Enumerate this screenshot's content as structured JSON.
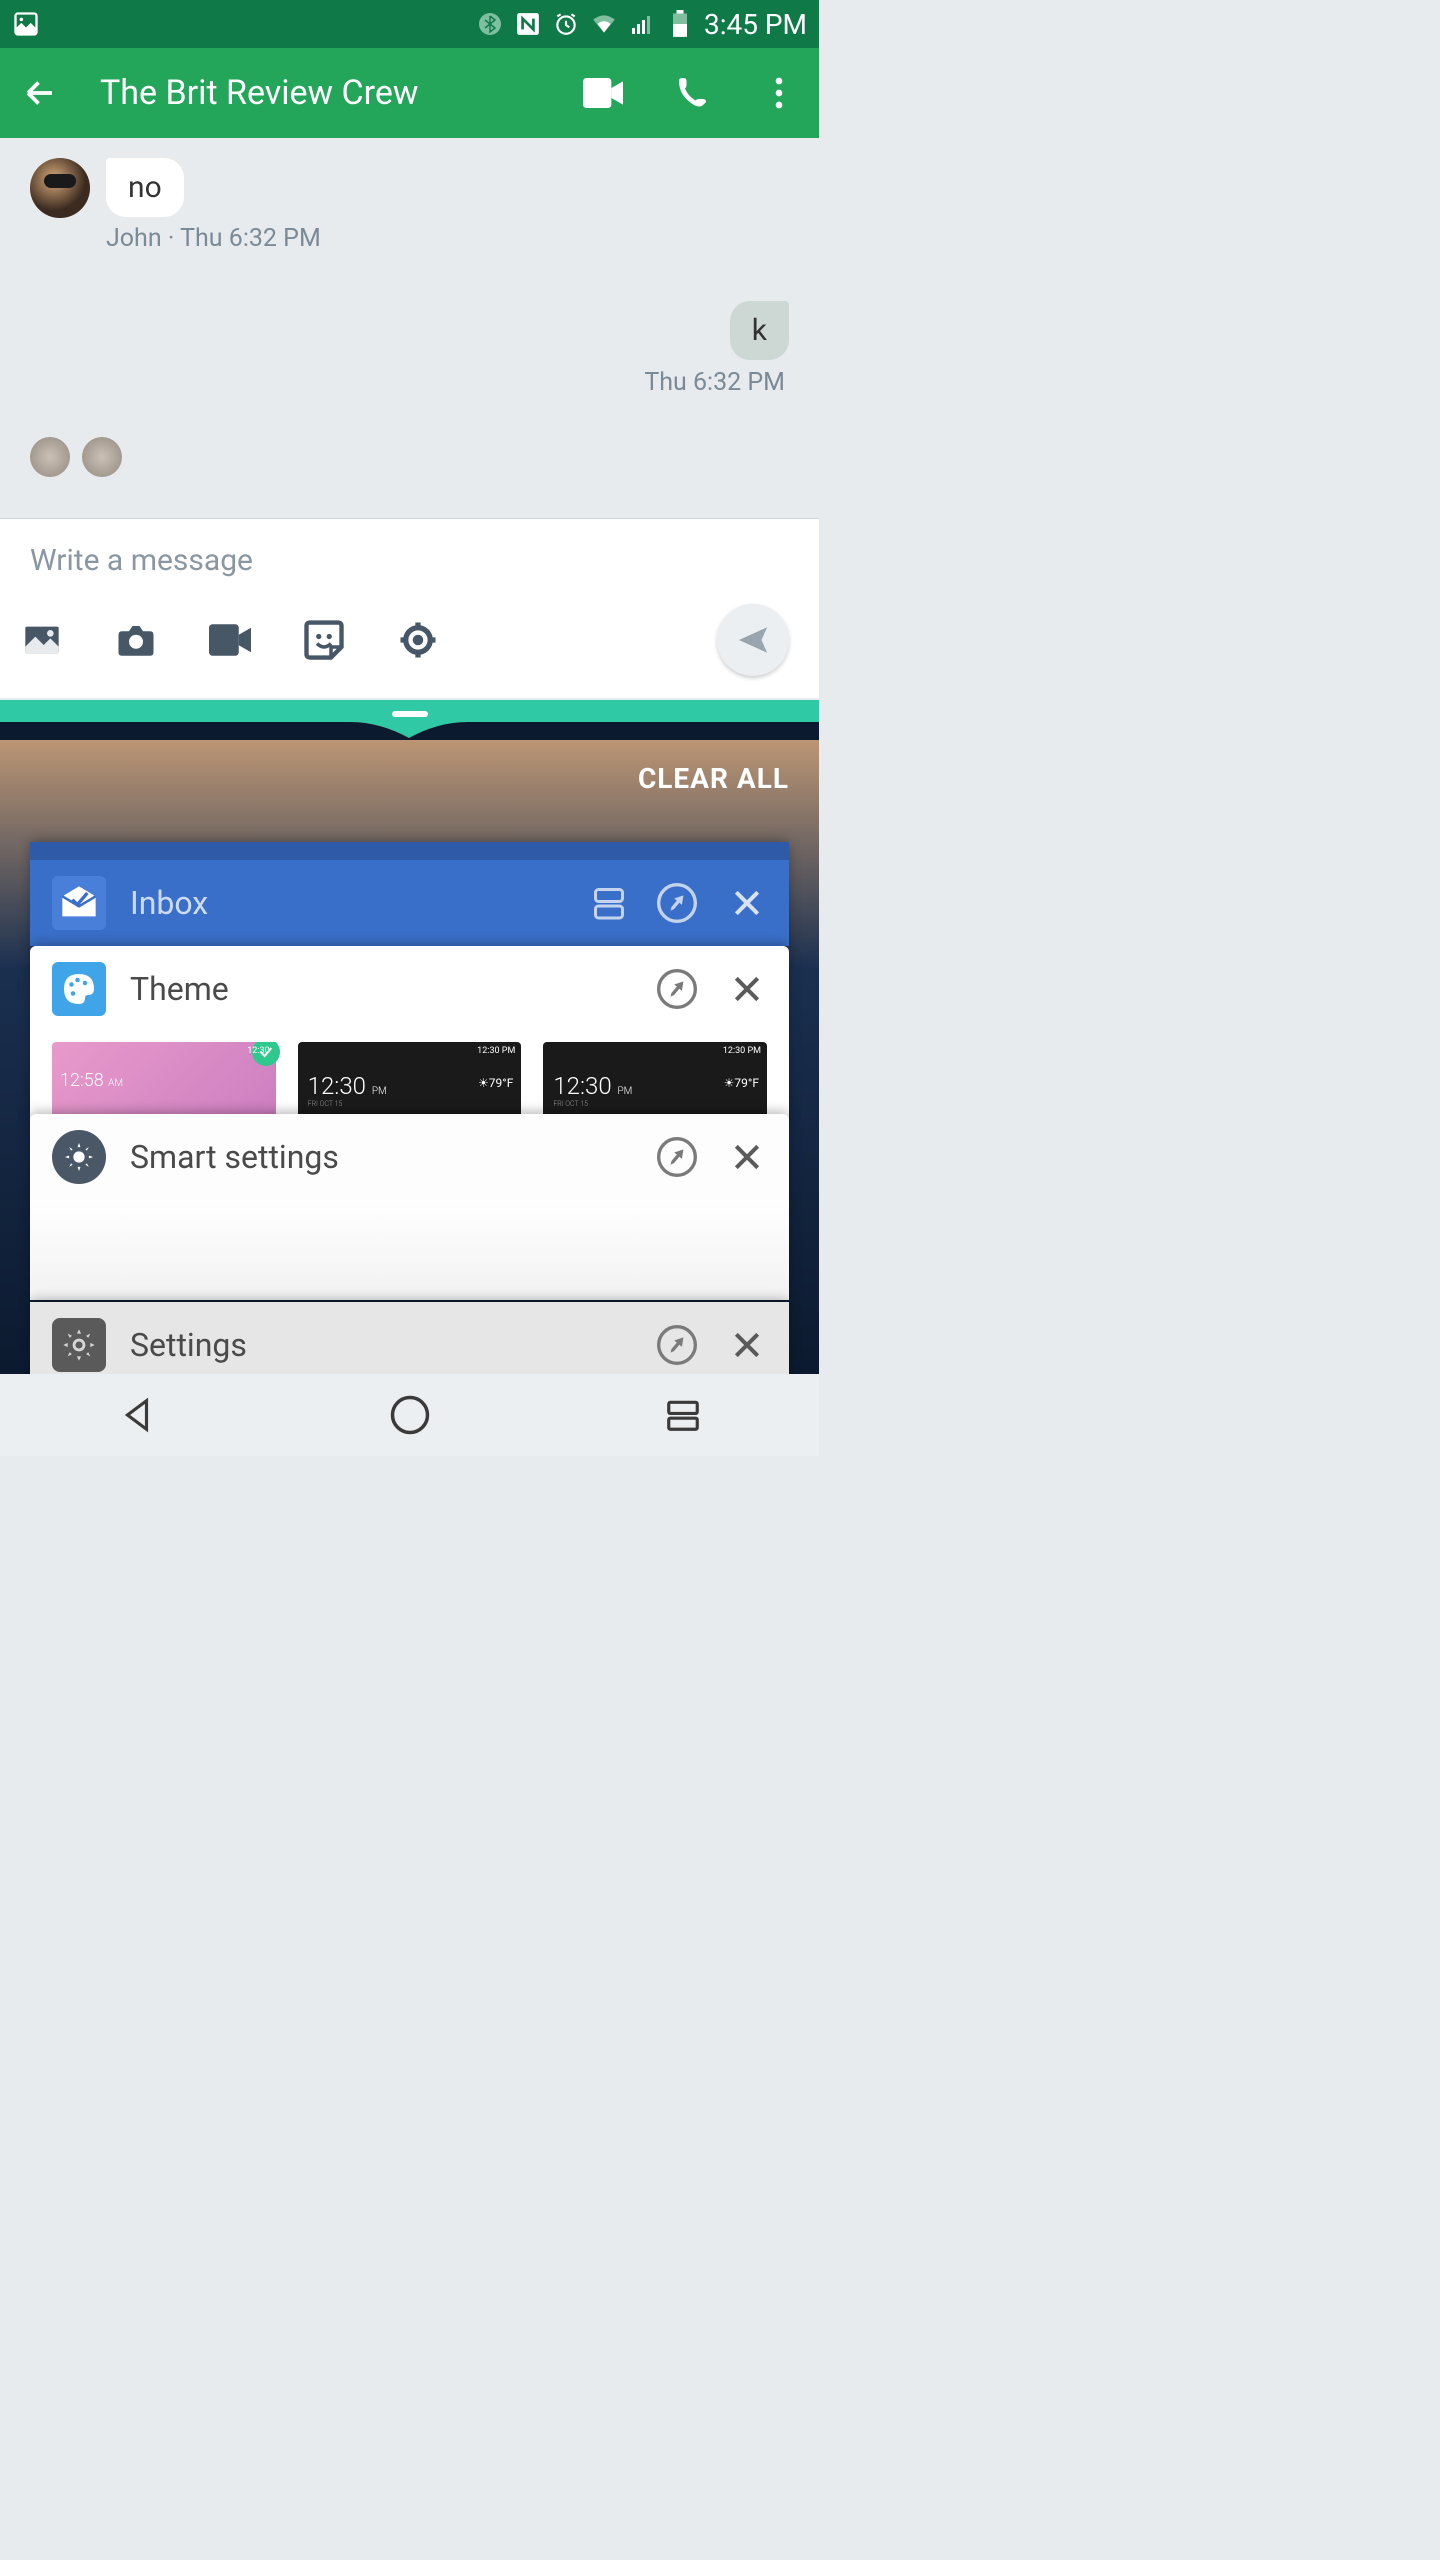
{
  "status": {
    "time": "3:45 PM"
  },
  "appbar": {
    "title": "The Brit Review Crew"
  },
  "chat": {
    "msg1": {
      "text": "no",
      "sender": "John",
      "time": "Thu 6:32 PM"
    },
    "msg2": {
      "text": "k",
      "time": "Thu 6:32 PM"
    }
  },
  "compose": {
    "placeholder": "Write a message"
  },
  "recents": {
    "clear_all": "CLEAR ALL",
    "cards": {
      "inbox": {
        "title": "Inbox"
      },
      "theme": {
        "title": "Theme",
        "thumbs": [
          {
            "time_h": "12:58",
            "time_s": "AM",
            "status": "12:30"
          },
          {
            "time_h": "12:30",
            "time_s": "PM",
            "status": "12:30 PM",
            "temp": "79°F",
            "date": "FRI OCT 15"
          },
          {
            "time_h": "12:30",
            "time_s": "PM",
            "status": "12:30 PM",
            "temp": "79°F",
            "date": "FRI OCT 15"
          }
        ]
      },
      "smart": {
        "title": "Smart settings"
      },
      "settings": {
        "title": "Settings"
      }
    }
  }
}
